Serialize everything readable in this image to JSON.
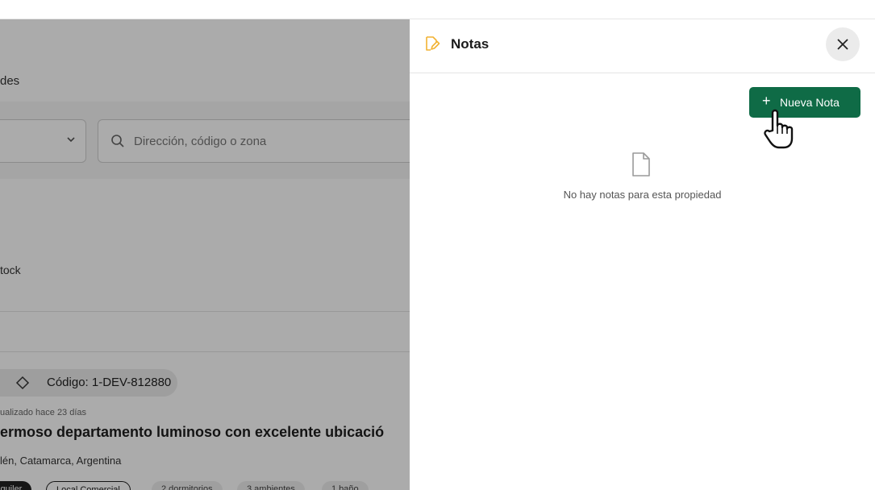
{
  "background": {
    "subtitle_partial": "des",
    "search_placeholder": "Dirección, código o zona",
    "stock_partial": "tock",
    "code_label": "Código: 1-DEV-812880",
    "updated_text": "ualizado hace 23 días",
    "listing_title": "ermoso departamento luminoso con excelente ubicació",
    "listing_location": "lén, Catamarca, Argentina",
    "chips": [
      "lquiler",
      "Local Comercial",
      "2 dormitorios",
      "3 ambientes",
      "1 baño"
    ]
  },
  "notes_panel": {
    "title": "Notas",
    "new_note_button": "Nueva Nota",
    "new_note_icon": "+",
    "empty_message": "No hay notas para esta propiedad"
  },
  "icons": {
    "notes": "edit-note-icon",
    "close": "close-icon",
    "empty": "file-icon",
    "search": "search-icon",
    "tag": "tag-icon",
    "chevron": "chevron-down-icon"
  },
  "colors": {
    "accent": "#0f6b46",
    "notes_icon": "#f2b233",
    "overlay": "rgba(0,0,0,0.33)"
  }
}
